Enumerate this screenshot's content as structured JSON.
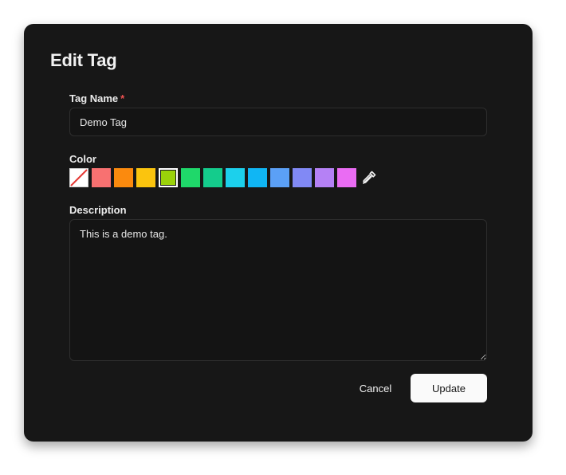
{
  "dialog": {
    "title": "Edit Tag"
  },
  "form": {
    "name_label": "Tag Name",
    "name_required_mark": "*",
    "name_value": "Demo Tag",
    "color_label": "Color",
    "description_label": "Description",
    "description_value": "This is a demo tag."
  },
  "colors": {
    "selected": "#9bd20a",
    "swatches": [
      {
        "name": "none",
        "hex": "none"
      },
      {
        "name": "red",
        "hex": "#f87171"
      },
      {
        "name": "orange",
        "hex": "#fb8a0e"
      },
      {
        "name": "amber",
        "hex": "#fbc40e"
      },
      {
        "name": "lime",
        "hex": "#9bd20a"
      },
      {
        "name": "green",
        "hex": "#1fd86a"
      },
      {
        "name": "emerald",
        "hex": "#14cc8c"
      },
      {
        "name": "cyan",
        "hex": "#1cd0ec"
      },
      {
        "name": "sky",
        "hex": "#10b6f4"
      },
      {
        "name": "blue",
        "hex": "#5ba0f6"
      },
      {
        "name": "indigo",
        "hex": "#8189f5"
      },
      {
        "name": "violet",
        "hex": "#b581f5"
      },
      {
        "name": "fuchsia",
        "hex": "#ea6cf3"
      }
    ],
    "picker_icon": "eyedropper-icon"
  },
  "actions": {
    "cancel_label": "Cancel",
    "update_label": "Update"
  }
}
